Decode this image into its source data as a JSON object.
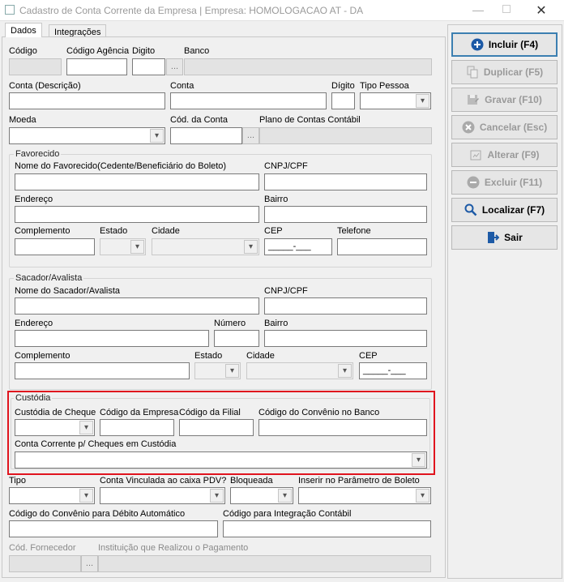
{
  "window": {
    "title": "Cadastro de Conta Corrente da Empresa | Empresa: HOMOLOGACAO AT - DA"
  },
  "tabs": [
    {
      "label": "Dados"
    },
    {
      "label": "Integrações"
    }
  ],
  "main": {
    "codigo": "Código",
    "codigo_agencia": "Código Agência",
    "digito1": "Digito",
    "banco": "Banco",
    "conta_descricao": "Conta (Descrição)",
    "conta": "Conta",
    "digito2": "Dígito",
    "tipo_pessoa": "Tipo Pessoa",
    "moeda": "Moeda",
    "cod_conta": "Cód. da Conta",
    "plano_contas": "Plano de Contas Contábil",
    "dots": "..."
  },
  "favorecido": {
    "title": "Favorecido",
    "nome": "Nome do Favorecido(Cedente/Beneficiário do Boleto)",
    "cnpj": "CNPJ/CPF",
    "endereco": "Endereço",
    "bairro": "Bairro",
    "complemento": "Complemento",
    "estado": "Estado",
    "cidade": "Cidade",
    "cep": "CEP",
    "telefone": "Telefone",
    "cep_mask": "_____-___"
  },
  "sacador": {
    "title": "Sacador/Avalista",
    "nome": "Nome do Sacador/Avalista",
    "cnpj": "CNPJ/CPF",
    "endereco": "Endereço",
    "numero": "Número",
    "bairro": "Bairro",
    "complemento": "Complemento",
    "estado": "Estado",
    "cidade": "Cidade",
    "cep": "CEP",
    "cep_mask": "_____-___"
  },
  "custodia": {
    "title": "Custódia",
    "custodia_cheque": "Custódia de Cheque",
    "cod_empresa": "Código da Empresa",
    "cod_filial": "Código da Filial",
    "cod_convenio": "Código do Convênio no Banco",
    "conta_corrente": "Conta Corrente p/ Cheques em Custódia",
    "highlight_color": "#e0141e"
  },
  "bottom": {
    "tipo": "Tipo",
    "conta_vinculada": "Conta Vinculada ao caixa PDV?",
    "bloqueada": "Bloqueada",
    "inserir_param": "Inserir no Parâmetro de Boleto",
    "cod_convenio_debito": "Código do Convênio para Débito Automático",
    "cod_integracao": "Código para Integração Contábil",
    "cod_fornecedor": "Cód. Fornecedor",
    "instituicao": "Instituição que Realizou o Pagamento"
  },
  "buttons": {
    "incluir": "Incluir (F4)",
    "duplicar": "Duplicar (F5)",
    "gravar": "Gravar (F10)",
    "cancelar": "Cancelar (Esc)",
    "alterar": "Alterar (F9)",
    "excluir": "Excluir (F11)",
    "localizar": "Localizar (F7)",
    "sair": "Sair"
  }
}
